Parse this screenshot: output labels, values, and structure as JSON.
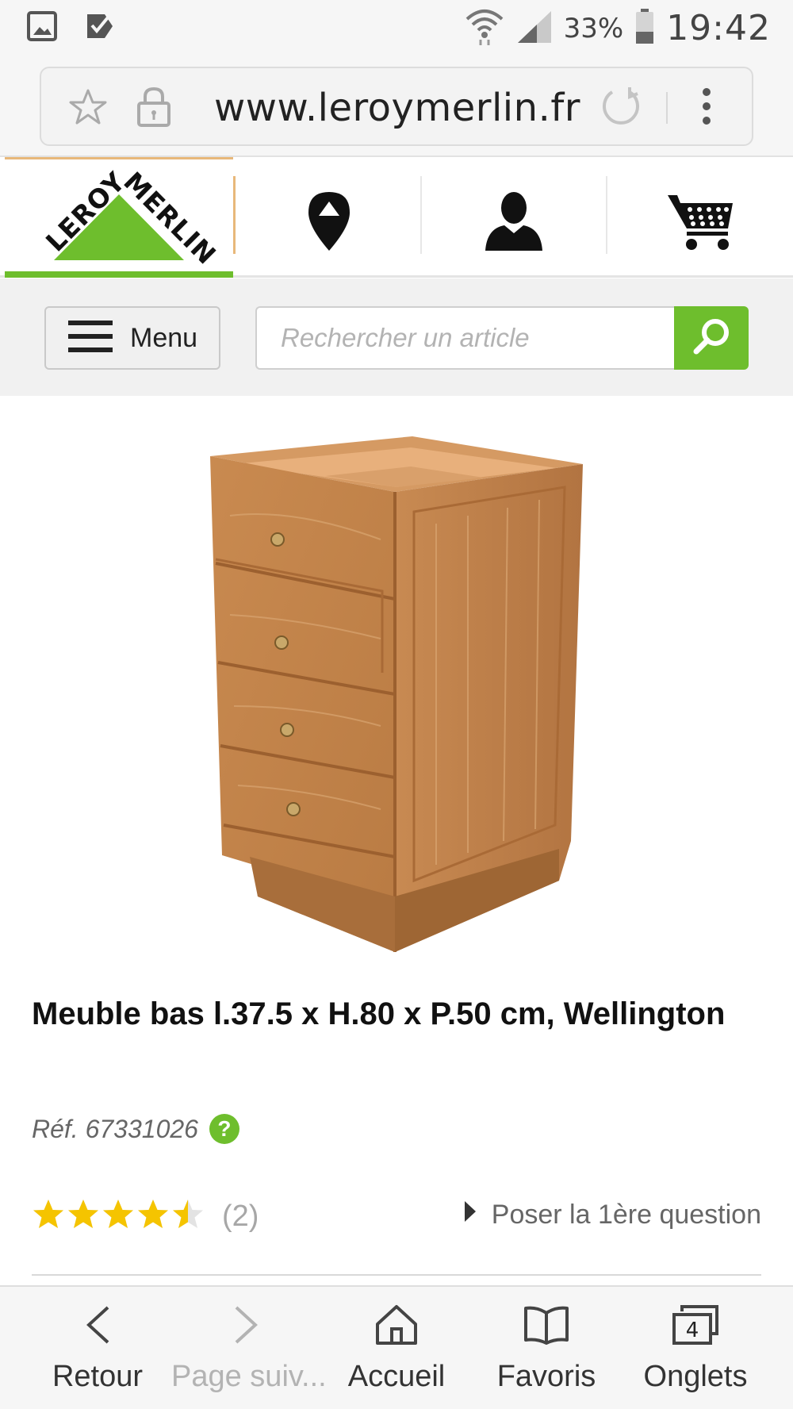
{
  "status_bar": {
    "battery": "33%",
    "time": "19:42",
    "icons": [
      "gallery-icon",
      "task-check-icon",
      "wifi-icon",
      "signal-icon",
      "battery-icon"
    ]
  },
  "browser": {
    "url": "www.leroymerlin.fr"
  },
  "site": {
    "logo_text": "LEROY MERLIN",
    "brand_green": "#6ebe2d",
    "accent_orange": "#e8b87a",
    "header_icons": [
      "store-locator-icon",
      "account-icon",
      "cart-icon"
    ]
  },
  "search": {
    "menu_label": "Menu",
    "placeholder": "Rechercher un article"
  },
  "product": {
    "title": "Meuble bas l.37.5 x H.80 x P.50 cm, Wellington",
    "reference": "Réf. 67331026",
    "help_label": "?",
    "rating_value": 4.5,
    "rating_max": 5,
    "review_count": "(2)",
    "question_link": "Poser la 1ère question"
  },
  "bottom_nav": {
    "back": "Retour",
    "forward": "Page suiv...",
    "home": "Accueil",
    "bookmarks": "Favoris",
    "tabs": "Onglets",
    "tab_count": "4"
  }
}
